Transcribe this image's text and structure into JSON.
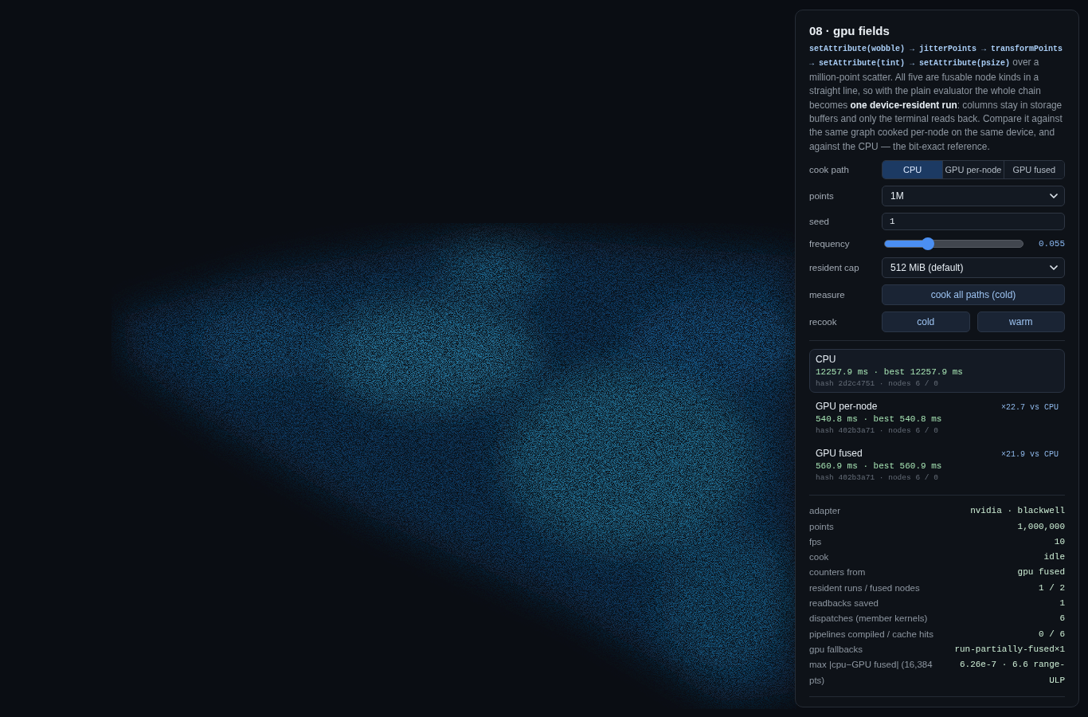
{
  "panel": {
    "title": "08 · gpu fields",
    "description": {
      "code": "setAttribute(wobble) → jitterPoints → transformPoints → setAttribute(tint) → setAttribute(psize)",
      "text": "over a million-point scatter. All five are fusable node kinds in a straight line, so with the plain evaluator the whole chain becomes **one device-resident run**: columns stay in storage buffers and only the terminal reads back. Compare it against the same graph cooked per-node on the same device, and against the CPU — the bit-exact reference."
    }
  },
  "controls": [
    {
      "kind": "segmented",
      "label": "cook path",
      "options": [
        {
          "label": "CPU",
          "selected": true
        },
        {
          "label": "GPU per-node",
          "selected": false
        },
        {
          "label": "GPU fused",
          "selected": false
        }
      ]
    },
    {
      "kind": "select",
      "label": "points",
      "value": "1M"
    },
    {
      "kind": "input",
      "label": "seed",
      "value": "1"
    },
    {
      "kind": "slider",
      "label": "frequency",
      "level": 0.31,
      "reading": "0.055"
    },
    {
      "kind": "select",
      "label": "resident cap",
      "value": "512 MiB (default)"
    },
    {
      "kind": "buttons",
      "label": "measure",
      "buttons": [
        "cook all paths (cold)"
      ]
    },
    {
      "kind": "buttons",
      "label": "recook",
      "buttons": [
        "cold",
        "warm"
      ]
    }
  ],
  "results": [
    {
      "name": "CPU",
      "selected": true,
      "timing": "12257.9 ms · best 12257.9 ms",
      "detail": "hash 2d2c4751 · nodes 6 / 0"
    },
    {
      "name": "GPU per-node",
      "selected": false,
      "speedup": "×22.7 vs CPU",
      "timing": "540.8 ms · best 540.8 ms",
      "detail": "hash 402b3a71 · nodes 6 / 0"
    },
    {
      "name": "GPU fused",
      "selected": false,
      "speedup": "×21.9 vs CPU",
      "timing": "560.9 ms · best 560.9 ms",
      "detail": "hash 402b3a71 · nodes 6 / 0"
    }
  ],
  "stats": [
    {
      "label": "adapter",
      "value": "nvidia · blackwell"
    },
    {
      "label": "points",
      "value": "1,000,000"
    },
    {
      "label": "fps",
      "value": "10"
    },
    {
      "label": "cook",
      "value": "idle"
    },
    {
      "label": "counters from",
      "value": "gpu fused"
    },
    {
      "label": "resident runs / fused nodes",
      "value": "1 / 2"
    },
    {
      "label": "readbacks saved",
      "value": "1"
    },
    {
      "label": "dispatches (member kernels)",
      "value": "6"
    },
    {
      "label": "pipelines compiled / cache hits",
      "value": "0 / 6"
    },
    {
      "label": "gpu fallbacks",
      "value": "run-partially-fused×1"
    },
    {
      "label": "max |cpu−GPU fused| (16,384 pts)",
      "value": "6.26e-7 · 6.6 range-ULP"
    }
  ]
}
